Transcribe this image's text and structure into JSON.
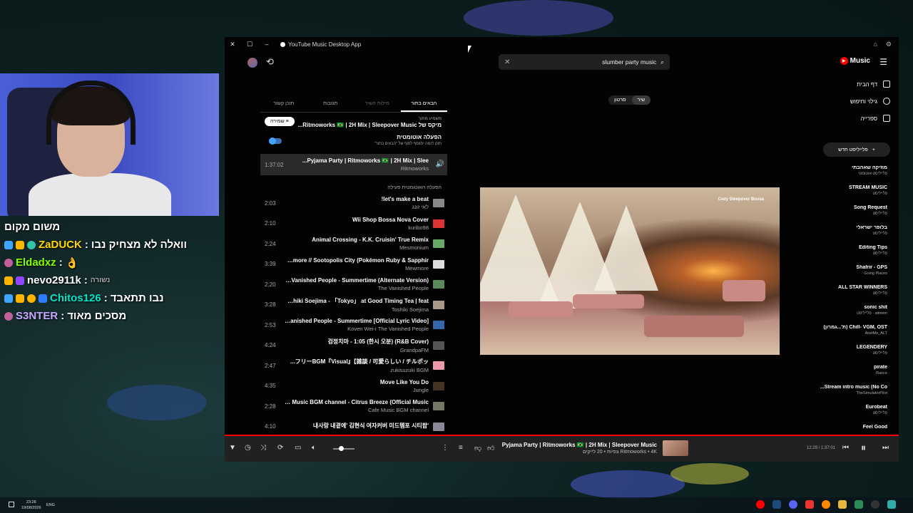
{
  "window": {
    "title": "YouTube Music Desktop App"
  },
  "search": {
    "query": "slumber party music"
  },
  "brand": {
    "name": "Music"
  },
  "tabs": [
    {
      "label": "תוכן קשור"
    },
    {
      "label": "תגובות"
    },
    {
      "label": "מילות השיר"
    },
    {
      "label": "הבאים בתור"
    }
  ],
  "queue": {
    "playing_from_label": "משמיע מתוך",
    "playing_from": "מיקס של Ritmoworks 🇧🇷 | 2H Mix | Sleepover Music...",
    "save_label": "שמירה",
    "autoplay_title": "הפעלה אוטומטית",
    "autoplay_sub": "תוכן דומה יתווסף לסוף של \"הבאים בתור\"",
    "current": {
      "title": "Pyjama Party | Ritmoworks 🇧🇷 | 2H Mix | Slee...",
      "artist": "Ritmoworks",
      "duration": "1:37:02"
    },
    "autoplay_header": "הפעלה האוטומטית פעילה",
    "items": [
      {
        "title": "let's make a beat!",
        "artist": "לאי זונג",
        "duration": "2:03"
      },
      {
        "title": "Wii Shop Bossa Nova Cover",
        "artist": "kuribo98",
        "duration": "2:10"
      },
      {
        "title": "Animal Crossing - K.K. Cruisin' True Remix",
        "artist": "Mesmonium",
        "duration": "2:24"
      },
      {
        "title": "Mewmore // Sootopolis City (Pokémon Ruby & Sapphir...",
        "artist": "Mewmore",
        "duration": "3:39"
      },
      {
        "title": "The Vanished People - Summertime (Alternate Version)",
        "artist": "The Vanished People",
        "duration": "2:20"
      },
      {
        "title": "Toshiki Soejima - 「Tokyo」 at Good Timing Tea | feat...",
        "artist": "Toshiki Soejima",
        "duration": "3:28"
      },
      {
        "title": "The Vanished People - Summertime [Official Lyric Video]",
        "artist": "The Vanished People ו-Koven Wei",
        "duration": "2:53"
      },
      {
        "title": "검정치마 - 1:05 (한시 오분) (R&B Cover)",
        "artist": "GrandpaFM",
        "duration": "4:24"
      },
      {
        "title": "フリーBGM『Visual』【雑談 / 可愛らしい / チルポッ...",
        "artist": "zukisuzuki BGM",
        "duration": "2:47"
      },
      {
        "title": "Move Like You Do",
        "artist": "Jungle",
        "duration": "4:35"
      },
      {
        "title": "Cafe Music BGM channel - Citrus Breeze (Official Music...",
        "artist": "Cafe Music BGM channel",
        "duration": "2:28"
      },
      {
        "title": "'내사랑 내곁에' 김현식 여자커버 미드템포 시티팝",
        "artist": "",
        "duration": "4:10"
      }
    ]
  },
  "player": {
    "song_label": "שיר",
    "video_label": "סרטון",
    "caption": "Cozy Sleepover Bossa"
  },
  "sidebar": {
    "nav": [
      {
        "label": "דף הבית"
      },
      {
        "label": "גילוי וחיפוש"
      },
      {
        "label": "ספרייה"
      }
    ],
    "new_playlist": "פלייליסט חדש",
    "playlists": [
      {
        "name": "מוזיקה שאהבתי",
        "owner": "פלייליסט אוטומטי"
      },
      {
        "name": "STREAM MUSIC",
        "owner": "פלייליסט"
      },
      {
        "name": "Song Request",
        "owner": "פלייליסט"
      },
      {
        "name": "בלופר ישראלי",
        "owner": "פלייליסט"
      },
      {
        "name": "Editing Tips",
        "owner": "פלייליסט"
      },
      {
        "name": "Shafrir - GPS",
        "owner": "Going Places"
      },
      {
        "name": "ALL STAR WINNERS",
        "owner": "פלייליסט"
      },
      {
        "name": "sonic shit",
        "owner": "stitmim · פלייליסט"
      },
      {
        "name": "Chill- VGM, OST (ת'...גמרון)",
        "owner": "ArielMe_ALT"
      },
      {
        "name": "LEGENDERY",
        "owner": "פלייליסט"
      },
      {
        "name": "pirate",
        "owner": "Rance"
      },
      {
        "name": "Stream intro music (No Co...",
        "owner": "TheSimulatorPilot"
      },
      {
        "name": "Eurobeat",
        "owner": "פלייליסט"
      },
      {
        "name": "Feel Good",
        "owner": ""
      }
    ]
  },
  "bottombar": {
    "title": "Pyjama Party | Ritmoworks 🇧🇷 | 2H Mix | Sleepover Music",
    "subtitle": "Ritmoworks • 4K צפיות • 20 לייקים",
    "time": "12:29 / 1:37:01"
  },
  "chat": [
    {
      "user": "",
      "message": "משום מקום",
      "color": "#ffffff"
    },
    {
      "user": "ZaDUCK",
      "message": "וואלה לא מצחיק נבו",
      "color": "#ffd700"
    },
    {
      "user": "Eldadxz",
      "message": "👌",
      "color": "#7fff00"
    },
    {
      "user": "nevo2911k",
      "message": "נשורה",
      "color": "#ffffff"
    },
    {
      "user": "Chitos126",
      "message": "נבו תתאבד",
      "color": "#00e5cc"
    },
    {
      "user": "S3NTER",
      "message": "מסכים מאוד",
      "color": "#c8a8ff"
    }
  ],
  "taskbar": {
    "time": "23:28",
    "date": "19/08/2026",
    "lang": "ENG"
  }
}
